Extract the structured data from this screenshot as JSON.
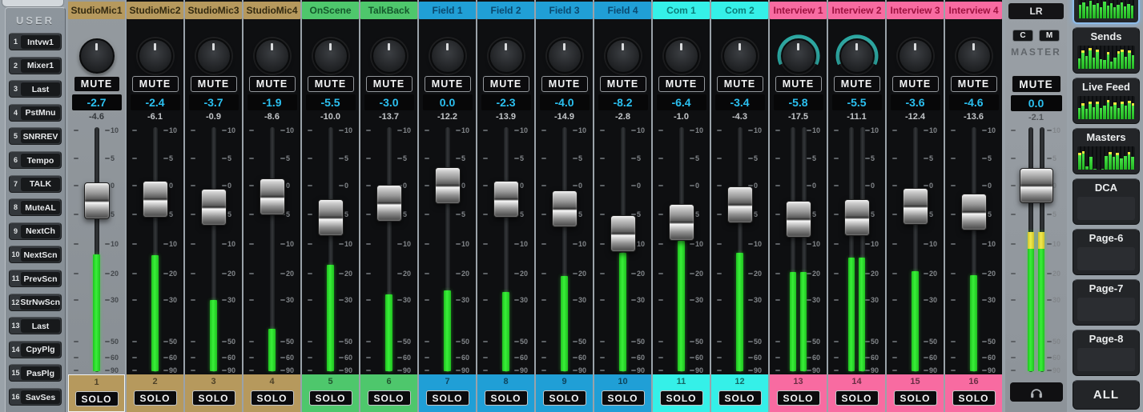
{
  "labels": {
    "mute": "MUTE",
    "solo": "SOLO"
  },
  "user_panel": {
    "title": "USER",
    "buttons": [
      {
        "num": "1",
        "label": "Intvw1"
      },
      {
        "num": "2",
        "label": "Mixer1"
      },
      {
        "num": "3",
        "label": "Last"
      },
      {
        "num": "4",
        "label": "PstMnu"
      },
      {
        "num": "5",
        "label": "SNRREV"
      },
      {
        "num": "6",
        "label": "Tempo"
      },
      {
        "num": "7",
        "label": "TALK"
      },
      {
        "num": "8",
        "label": "MuteAL"
      },
      {
        "num": "9",
        "label": "NextCh"
      },
      {
        "num": "10",
        "label": "NextScn"
      },
      {
        "num": "11",
        "label": "PrevScn"
      },
      {
        "num": "12",
        "label": "StrNwScn"
      },
      {
        "num": "13",
        "label": "Last"
      },
      {
        "num": "14",
        "label": "CpyPlg"
      },
      {
        "num": "15",
        "label": "PasPlg"
      },
      {
        "num": "16",
        "label": "SavSes"
      }
    ]
  },
  "fader_scale": {
    "ticks": [
      {
        "label": "10",
        "db": 10
      },
      {
        "label": "5",
        "db": 5
      },
      {
        "label": "0",
        "db": 0
      },
      {
        "label": "5",
        "db": -5
      },
      {
        "label": "10",
        "db": -10
      },
      {
        "label": "20",
        "db": -20
      },
      {
        "label": "30",
        "db": -30
      },
      {
        "label": "50",
        "db": -50
      },
      {
        "label": "60",
        "db": -60
      },
      {
        "label": "90",
        "db": -90
      }
    ]
  },
  "channels": [
    {
      "num": "1",
      "name": "StudioMic1",
      "group": "studio",
      "fader_value": "-2.7",
      "level_value": "-4.6",
      "fader_db": -2.7,
      "meter_db": -13.5,
      "selected": true,
      "stereo": false,
      "knob_arc": false
    },
    {
      "num": "2",
      "name": "StudioMic2",
      "group": "studio",
      "fader_value": "-2.4",
      "level_value": "-6.1",
      "fader_db": -2.4,
      "meter_db": -13.8,
      "selected": false,
      "stereo": false,
      "knob_arc": false
    },
    {
      "num": "3",
      "name": "StudioMic3",
      "group": "studio",
      "fader_value": "-3.7",
      "level_value": "-0.9",
      "fader_db": -3.7,
      "meter_db": -30,
      "selected": false,
      "stereo": false,
      "knob_arc": false
    },
    {
      "num": "4",
      "name": "StudioMic4",
      "group": "studio",
      "fader_value": "-1.9",
      "level_value": "-8.6",
      "fader_db": -1.9,
      "meter_db": -44,
      "selected": false,
      "stereo": false,
      "knob_arc": false
    },
    {
      "num": "5",
      "name": "OnScene",
      "group": "green",
      "fader_value": "-5.5",
      "level_value": "-10.0",
      "fader_db": -5.5,
      "meter_db": -17,
      "selected": false,
      "stereo": false,
      "knob_arc": false
    },
    {
      "num": "6",
      "name": "TalkBack",
      "group": "green",
      "fader_value": "-3.0",
      "level_value": "-13.7",
      "fader_db": -3.0,
      "meter_db": -28,
      "selected": false,
      "stereo": false,
      "knob_arc": false
    },
    {
      "num": "7",
      "name": "Field 1",
      "group": "blue",
      "fader_value": "0.0",
      "level_value": "-12.2",
      "fader_db": 0.0,
      "meter_db": -26.5,
      "selected": false,
      "stereo": false,
      "knob_arc": false
    },
    {
      "num": "8",
      "name": "Field 2",
      "group": "blue",
      "fader_value": "-2.3",
      "level_value": "-13.9",
      "fader_db": -2.3,
      "meter_db": -27,
      "selected": false,
      "stereo": false,
      "knob_arc": false
    },
    {
      "num": "9",
      "name": "Field 3",
      "group": "blue",
      "fader_value": "-4.0",
      "level_value": "-14.9",
      "fader_db": -4.0,
      "meter_db": -21,
      "selected": false,
      "stereo": false,
      "knob_arc": false
    },
    {
      "num": "10",
      "name": "Field 4",
      "group": "blue",
      "fader_value": "-8.2",
      "level_value": "-2.8",
      "fader_db": -8.2,
      "meter_db": -13,
      "selected": false,
      "stereo": false,
      "knob_arc": false
    },
    {
      "num": "11",
      "name": "Com 1",
      "group": "cyan",
      "fader_value": "-6.4",
      "level_value": "-1.0",
      "fader_db": -6.4,
      "meter_db": -9.5,
      "selected": false,
      "stereo": false,
      "knob_arc": false
    },
    {
      "num": "12",
      "name": "Com 2",
      "group": "cyan",
      "fader_value": "-3.4",
      "level_value": "-4.3",
      "fader_db": -3.4,
      "meter_db": -13,
      "selected": false,
      "stereo": false,
      "knob_arc": false
    },
    {
      "num": "13",
      "name": "Interview 1",
      "group": "pink",
      "fader_value": "-5.8",
      "level_value": "-17.5",
      "fader_db": -5.8,
      "meter_db": -19.5,
      "selected": false,
      "stereo": true,
      "knob_arc": true
    },
    {
      "num": "14",
      "name": "Interview 2",
      "group": "pink",
      "fader_value": "-5.5",
      "level_value": "-11.1",
      "fader_db": -5.5,
      "meter_db": -14.6,
      "selected": false,
      "stereo": true,
      "knob_arc": true
    },
    {
      "num": "15",
      "name": "Interview 3",
      "group": "pink",
      "fader_value": "-3.6",
      "level_value": "-12.4",
      "fader_db": -3.6,
      "meter_db": -19.2,
      "selected": false,
      "stereo": false,
      "knob_arc": false
    },
    {
      "num": "16",
      "name": "Interview 4",
      "group": "pink",
      "fader_value": "-4.6",
      "level_value": "-13.6",
      "fader_db": -4.6,
      "meter_db": -20.5,
      "selected": false,
      "stereo": false,
      "knob_arc": false
    }
  ],
  "master": {
    "header": "LR",
    "c_button": "C",
    "m_button": "M",
    "label": "MASTER",
    "fader_value": "0.0",
    "level_value": "-2.1",
    "fader_db": 0.0,
    "meter_db": -8,
    "meter_yellow_to_db": -11.5,
    "stereo": true
  },
  "right_panel": {
    "tiles": [
      {
        "id": "channels",
        "label": "",
        "selected": true,
        "yellow_tips": false,
        "meter": [
          68,
          80,
          60,
          88,
          70,
          78,
          58,
          85,
          65,
          75,
          55,
          70,
          82,
          62,
          74,
          66
        ]
      },
      {
        "id": "sends",
        "label": "Sends",
        "selected": false,
        "yellow_tips": true,
        "meter": [
          45,
          70,
          55,
          78,
          48,
          72,
          42,
          38,
          62,
          32,
          50,
          65,
          72,
          52,
          68,
          58
        ]
      },
      {
        "id": "live_feed",
        "label": "Live Feed",
        "selected": false,
        "yellow_tips": true,
        "meter": [
          50,
          60,
          45,
          66,
          52,
          64,
          48,
          58,
          72,
          55,
          62,
          50,
          66,
          58,
          70,
          60
        ]
      },
      {
        "id": "masters",
        "label": "Masters",
        "selected": false,
        "yellow_tips": true,
        "meter_groups": [
          [
            62,
            70,
            14,
            55,
            0
          ],
          [
            0,
            58,
            64,
            55,
            62,
            50,
            58,
            64,
            54
          ]
        ]
      },
      {
        "id": "dca",
        "label": "DCA",
        "selected": false
      },
      {
        "id": "page6",
        "label": "Page-6",
        "selected": false
      },
      {
        "id": "page7",
        "label": "Page-7",
        "selected": false
      },
      {
        "id": "page8",
        "label": "Page-8",
        "selected": false
      },
      {
        "id": "all",
        "label": "ALL",
        "selected": false
      }
    ]
  },
  "colors": {
    "studio": {
      "bg": "#b6995d",
      "fg": "#332a10"
    },
    "green": {
      "bg": "#4ec76c",
      "fg": "#14592c"
    },
    "blue": {
      "bg": "#209fd6",
      "fg": "#0a4a70"
    },
    "cyan": {
      "bg": "#35f0e8",
      "fg": "#0c7e79"
    },
    "pink": {
      "bg": "#f86ba1",
      "fg": "#9e1240"
    },
    "value_cyan": "#2bc0f0",
    "meter_green": "#2ce32c",
    "meter_yellow": "#ece73e",
    "knob_arc_teal": "#2aa9a3"
  }
}
